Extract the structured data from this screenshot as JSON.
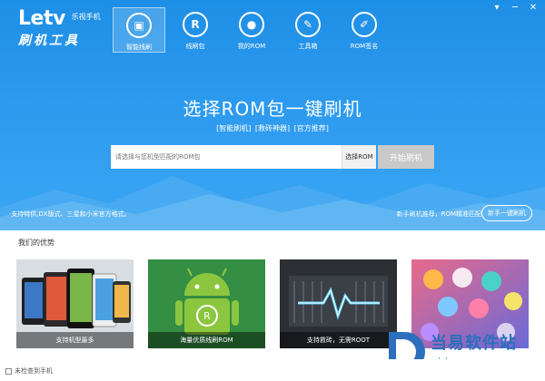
{
  "window": {
    "controls": [
      "▾",
      "─",
      "✕"
    ]
  },
  "logo": {
    "brand": "Letv",
    "sub": "乐视手机",
    "name": "刷机工具"
  },
  "nav": [
    {
      "label": "智能线刷",
      "icon": "smart-flash-icon",
      "glyph": "▣",
      "active": true
    },
    {
      "label": "线刷包",
      "icon": "rom-package-icon",
      "glyph": "R",
      "active": false
    },
    {
      "label": "我的ROM",
      "icon": "user-icon",
      "glyph": "●",
      "active": false
    },
    {
      "label": "工具箱",
      "icon": "wrench-icon",
      "glyph": "✎",
      "active": false
    },
    {
      "label": "ROM签名",
      "icon": "pen-icon",
      "glyph": "✐",
      "active": false
    }
  ],
  "hero": {
    "headline": "选择ROM包一键刷机",
    "tags": [
      "[智能刷机]",
      "[救砖神器]",
      "[官方推荐]"
    ]
  },
  "search": {
    "placeholder": "请选择与您机型匹配的ROM包",
    "choose_label": "选择ROM",
    "start_label": "开始刷机"
  },
  "support_note": "·支持特供,DX版式、三星和小米官方格式。",
  "recommend": "新手刷机推荐，ROM精准匹配",
  "newbie_button": "新手一键刷机",
  "advantages": {
    "title": "我们的优势",
    "cards": [
      {
        "caption": "支持机型最多",
        "name": "card-devices"
      },
      {
        "caption": "海量优质线刷ROM",
        "name": "card-android"
      },
      {
        "caption": "支持救砖，无需ROOT",
        "name": "card-unbrick"
      },
      {
        "caption": "",
        "name": "card-apps"
      }
    ]
  },
  "status": {
    "auto_check_label": "未检查到手机"
  },
  "watermark": {
    "text": "当易软件站",
    "url": "ddooo.com"
  },
  "colors": {
    "primary_blue": "#2f9cf0",
    "android_green": "#8cc63f",
    "disabled_gray": "#c9c9c9"
  }
}
